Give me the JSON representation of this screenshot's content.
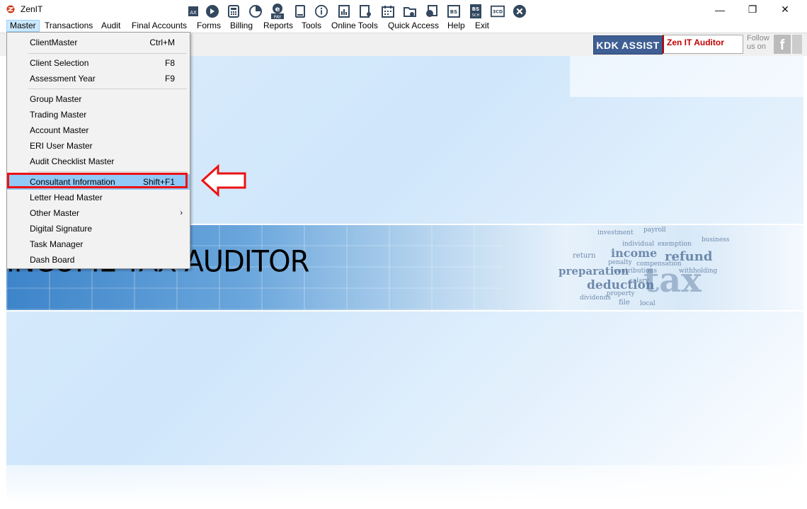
{
  "window": {
    "title": "ZenIT",
    "minimize": "—",
    "restore": "❐",
    "close": "✕"
  },
  "menubar": [
    {
      "label": "Master",
      "active": true
    },
    {
      "label": "Transactions"
    },
    {
      "label": "Audit"
    },
    {
      "label": "Final Accounts"
    },
    {
      "label": "Forms"
    },
    {
      "label": "Billing"
    },
    {
      "label": "Reports"
    },
    {
      "label": "Tools"
    },
    {
      "label": "Online Tools"
    },
    {
      "label": "Quick Access"
    },
    {
      "label": "Help"
    },
    {
      "label": "Exit"
    }
  ],
  "toolbar": {
    "icons": [
      "tax-icon",
      "arrow-circle-icon",
      "calculator-icon",
      "pie-chart-icon",
      "epay-icon",
      "book-icon",
      "info-icon",
      "bar-report-icon",
      "user-report-icon",
      "calendar-icon",
      "folder-add-icon",
      "backup-icon",
      "bs-icon",
      "bs-sch-icon",
      "3cd-icon",
      "close-circle-icon"
    ],
    "icon_texts": {
      "epay": "PAY",
      "bs": "BS",
      "bs_sch": "BS",
      "bs_sch_sub": "SCH",
      "cd3": "3CD",
      "tax": "AX"
    },
    "kdk_assist": "KDK ASSIST",
    "zen_auditor": "Zen IT Auditor",
    "follow_line1": "Follow",
    "follow_line2": "us on",
    "facebook": "f"
  },
  "master_menu": {
    "items": [
      {
        "label": "ClientMaster",
        "shortcut": "Ctrl+M"
      },
      {
        "label": "Client Selection",
        "shortcut": "F8"
      },
      {
        "label": "Assessment Year",
        "shortcut": "F9"
      },
      {
        "label": "Group Master",
        "shortcut": ""
      },
      {
        "label": "Trading Master",
        "shortcut": ""
      },
      {
        "label": "Account Master",
        "shortcut": ""
      },
      {
        "label": "ERI User Master",
        "shortcut": ""
      },
      {
        "label": "Audit Checklist Master",
        "shortcut": ""
      },
      {
        "label": "Consultant Information",
        "shortcut": "Shift+F1"
      },
      {
        "label": "Letter Head Master",
        "shortcut": ""
      },
      {
        "label": "Other Master",
        "shortcut": "›"
      },
      {
        "label": "Digital Signature",
        "shortcut": ""
      },
      {
        "label": "Task Manager",
        "shortcut": ""
      },
      {
        "label": "Dash Board",
        "shortcut": ""
      }
    ]
  },
  "banner": {
    "title": "INCOME TAX AUDITOR",
    "words": [
      "income",
      "refund",
      "preparation",
      "deduction",
      "tax",
      "payroll",
      "investment",
      "return",
      "penalty",
      "salary",
      "contributions",
      "dividends",
      "file",
      "local",
      "property",
      "individual",
      "business",
      "exemption",
      "compensation",
      "withholding"
    ]
  },
  "colors": {
    "accent_highlight": "#91c9f7",
    "annotation_red": "#ee1111",
    "kdk_blue": "#3f5f94",
    "zen_red": "#c00000"
  }
}
